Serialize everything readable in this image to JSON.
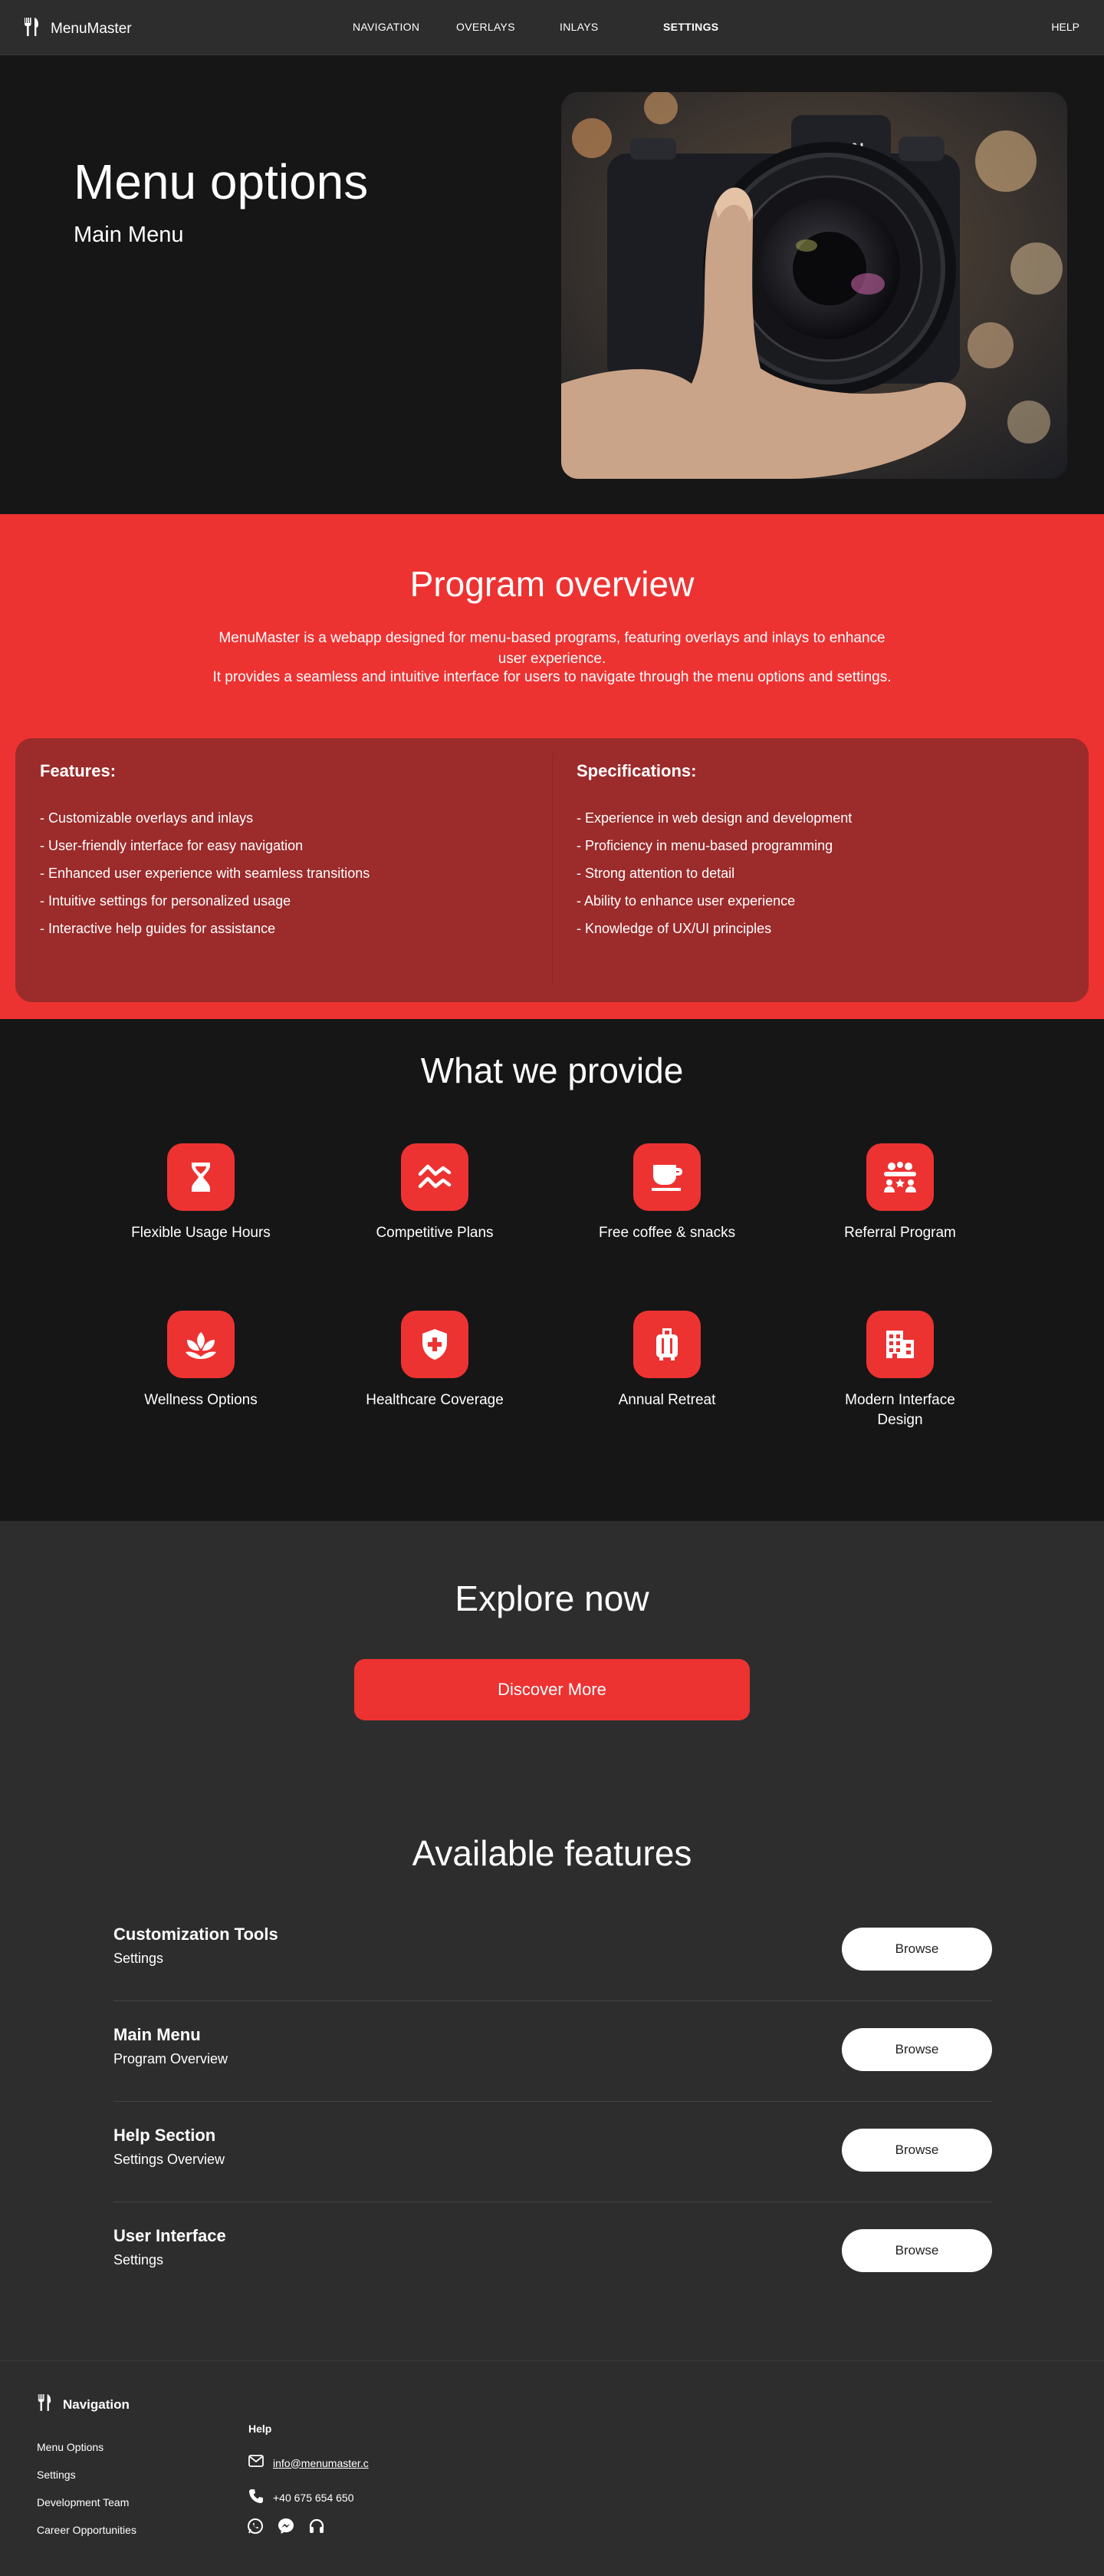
{
  "nav": {
    "brand": "MenuMaster",
    "links": [
      "NAVIGATION",
      "OVERLAYS",
      "INLAYS",
      "SETTINGS"
    ],
    "help": "HELP",
    "active": "SETTINGS"
  },
  "hero": {
    "title": "Menu options",
    "subtitle": "Main Menu",
    "camera_brand": "eSGN"
  },
  "overview": {
    "title": "Program overview",
    "description_1": "MenuMaster is a webapp designed for menu-based programs, featuring overlays and inlays to enhance user experience.",
    "description_2": "It provides a seamless and intuitive interface for users to navigate through the menu options and settings.",
    "features_title": "Features:",
    "features": [
      "- Customizable overlays and inlays",
      "- User-friendly interface for easy navigation",
      "- Enhanced user experience with seamless transitions",
      "- Intuitive settings for personalized usage",
      "- Interactive help guides for assistance"
    ],
    "specs_title": "Specifications:",
    "specs": [
      "- Experience in web design and development",
      "- Proficiency in menu-based programming",
      "- Strong attention to detail",
      "- Ability to enhance user experience",
      "- Knowledge of UX/UI principles"
    ]
  },
  "provide": {
    "title": "What we provide",
    "items": [
      {
        "label": "Flexible Usage Hours",
        "icon": "hourglass-icon"
      },
      {
        "label": "Competitive Plans",
        "icon": "wave-chart-icon"
      },
      {
        "label": "Free coffee & snacks",
        "icon": "coffee-cup-icon"
      },
      {
        "label": "Referral Program",
        "icon": "people-group-icon"
      },
      {
        "label": "Wellness Options",
        "icon": "lotus-icon"
      },
      {
        "label": "Healthcare Coverage",
        "icon": "medical-shield-icon"
      },
      {
        "label": "Annual Retreat",
        "icon": "luggage-icon"
      },
      {
        "label": "Modern Interface Design",
        "icon": "building-icon"
      }
    ]
  },
  "explore": {
    "title": "Explore now",
    "button": "Discover More"
  },
  "features": {
    "title": "Available features",
    "rows": [
      {
        "title": "Customization Tools",
        "subtitle": "Settings",
        "button": "Browse"
      },
      {
        "title": "Main Menu",
        "subtitle": "Program Overview",
        "button": "Browse"
      },
      {
        "title": "Help Section",
        "subtitle": "Settings Overview",
        "button": "Browse"
      },
      {
        "title": "User Interface",
        "subtitle": "Settings",
        "button": "Browse"
      }
    ]
  },
  "footer": {
    "brand": "Navigation",
    "links": [
      "Menu Options",
      "Settings",
      "Development Team",
      "Career Opportunities"
    ],
    "help_title": "Help",
    "email": "info@menumaster.c",
    "phone": "+40 675 654 650",
    "social": [
      "whatsapp-icon",
      "messenger-icon",
      "headphones-icon"
    ]
  },
  "colors": {
    "accent": "#ed3232",
    "card": "#9c2b2b",
    "dark": "#161616",
    "panel": "#2d2d2d"
  }
}
